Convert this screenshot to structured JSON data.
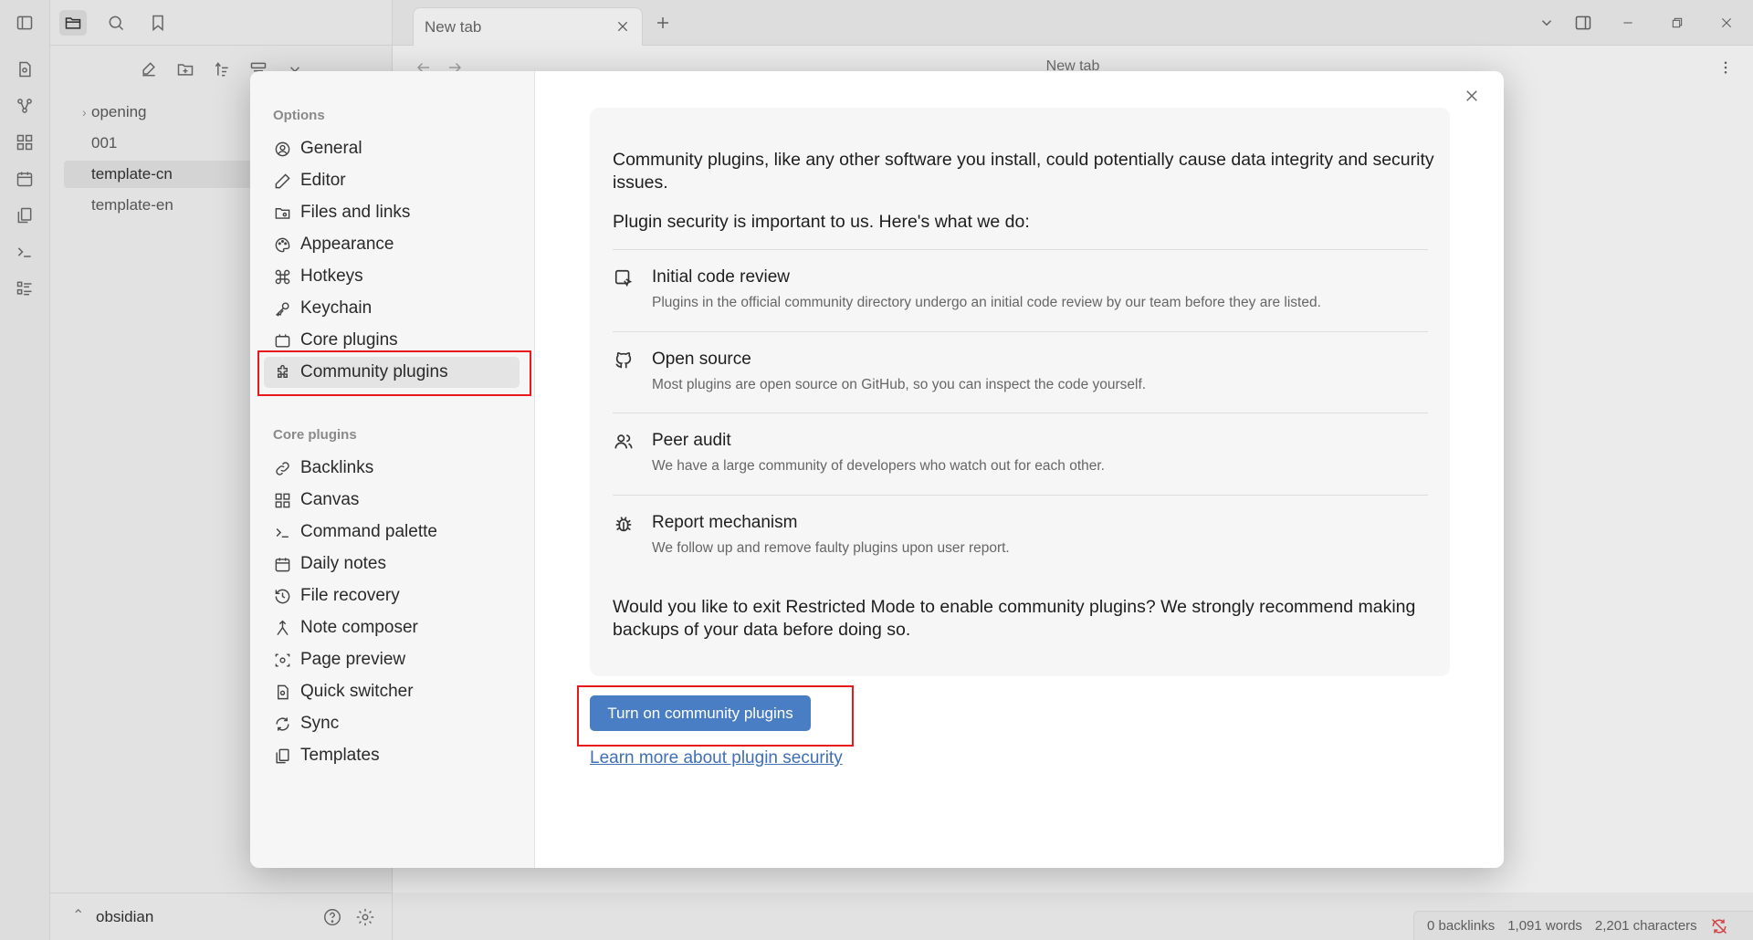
{
  "explorer": {
    "files": [
      {
        "label": "opening",
        "folder": true
      },
      {
        "label": "001",
        "folder": false
      },
      {
        "label": "template-cn",
        "folder": false,
        "selected": true
      },
      {
        "label": "template-en",
        "folder": false
      }
    ],
    "vault_name": "obsidian"
  },
  "tabbar": {
    "tab_title": "New tab"
  },
  "main": {
    "title": "New tab"
  },
  "statusbar": {
    "backlinks": "0 backlinks",
    "words": "1,091 words",
    "characters": "2,201 characters"
  },
  "modal": {
    "options_heading": "Options",
    "options": [
      "General",
      "Editor",
      "Files and links",
      "Appearance",
      "Hotkeys",
      "Keychain",
      "Core plugins",
      "Community plugins"
    ],
    "core_heading": "Core plugins",
    "core_plugins": [
      "Backlinks",
      "Canvas",
      "Command palette",
      "Daily notes",
      "File recovery",
      "Note composer",
      "Page preview",
      "Quick switcher",
      "Sync",
      "Templates"
    ],
    "intro": "Community plugins, like any other software you install, could potentially cause data integrity and security issues.",
    "security_lead": "Plugin security is important to us. Here's what we do:",
    "features": [
      {
        "title": "Initial code review",
        "desc": "Plugins in the official community directory undergo an initial code review by our team before they are listed.",
        "icon": "code-review-icon"
      },
      {
        "title": "Open source",
        "desc": "Most plugins are open source on GitHub, so you can inspect the code yourself.",
        "icon": "github-icon"
      },
      {
        "title": "Peer audit",
        "desc": "We have a large community of developers who watch out for each other.",
        "icon": "users-icon"
      },
      {
        "title": "Report mechanism",
        "desc": "We follow up and remove faulty plugins upon user report.",
        "icon": "bug-icon"
      }
    ],
    "question": "Would you like to exit Restricted Mode to enable community plugins? We strongly recommend making backups of your data before doing so.",
    "primary_button": "Turn on community plugins",
    "learn_link": "Learn more about plugin security"
  },
  "colors": {
    "accent": "#4a7ec4",
    "highlight": "#e8191c",
    "link": "#3f6fb5"
  }
}
